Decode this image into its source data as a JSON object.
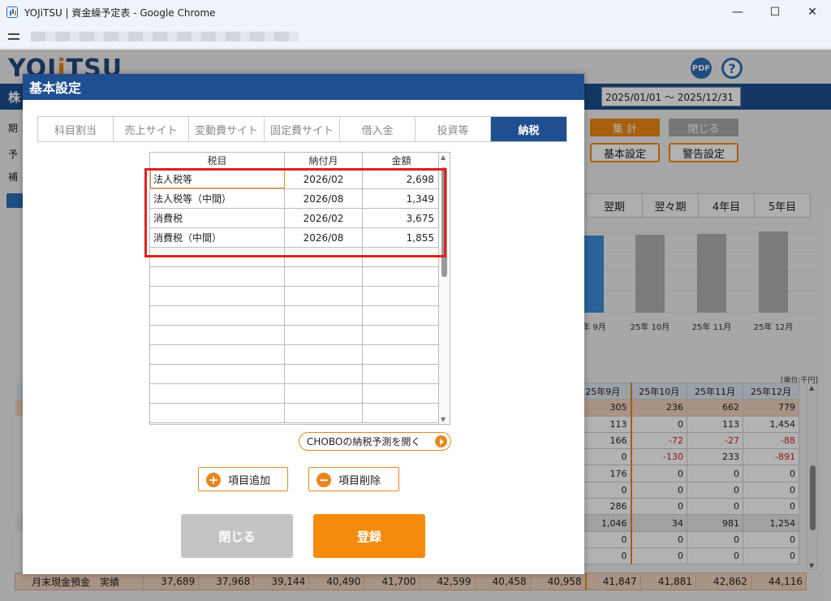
{
  "window": {
    "title": "YOJiTSU | 資金繰予定表 - Google Chrome",
    "minimize": "—",
    "maximize": "☐",
    "close": "✕"
  },
  "app": {
    "logo": {
      "a": "Y",
      "b": "O",
      "c": "J",
      "d": "i",
      "e": "TSU"
    },
    "pdf_label": "PDF",
    "help_label": "?",
    "company_prefix": "株",
    "date_range": "2025/01/01 〜 2025/12/31",
    "labels": {
      "period": "期",
      "plan": "予",
      "supplement": "補"
    },
    "buttons": {
      "aggregate": "集 計",
      "close": "閉じる",
      "basic_settings": "基本設定",
      "warning_settings": "警告設定"
    },
    "period_tabs": [
      "翌期",
      "翌々期",
      "4年目",
      "5年目"
    ],
    "chart_labels": [
      "年 9月",
      "25年 10月",
      "25年 11月",
      "25年 12月"
    ],
    "unit": "[単位:千円]",
    "grid": {
      "headers": [
        "25年9月",
        "25年10月",
        "25年11月",
        "25年12月"
      ],
      "rows": [
        {
          "style": "peach",
          "values": [
            "305",
            "236",
            "662",
            "779"
          ]
        },
        {
          "style": "",
          "values": [
            "113",
            "0",
            "113",
            "1,454"
          ]
        },
        {
          "style": "",
          "values": [
            "166",
            "-72",
            "-27",
            "-88"
          ]
        },
        {
          "style": "",
          "values": [
            "0",
            "-130",
            "233",
            "-891"
          ]
        },
        {
          "style": "",
          "values": [
            "176",
            "0",
            "0",
            "0"
          ]
        },
        {
          "style": "",
          "values": [
            "0",
            "0",
            "0",
            "0"
          ]
        },
        {
          "style": "",
          "values": [
            "286",
            "0",
            "0",
            "0"
          ]
        },
        {
          "style": "gray",
          "values": [
            "1,046",
            "34",
            "981",
            "1,254"
          ]
        },
        {
          "style": "",
          "values": [
            "0",
            "0",
            "0",
            "0"
          ]
        },
        {
          "style": "",
          "values": [
            "0",
            "0",
            "0",
            "0"
          ]
        }
      ]
    },
    "total_row": {
      "label": "月末現金預金　実績",
      "values": [
        "37,689",
        "37,968",
        "39,144",
        "40,490",
        "41,700",
        "42,599",
        "40,458",
        "40,958",
        "41,847",
        "41,881",
        "42,862",
        "44,116"
      ]
    }
  },
  "modal": {
    "title": "基本設定",
    "tabs": [
      {
        "label": "科目割当",
        "active": false
      },
      {
        "label": "売上サイト",
        "active": false
      },
      {
        "label": "変動費サイト",
        "active": false
      },
      {
        "label": "固定費サイト",
        "active": false
      },
      {
        "label": "借入金",
        "active": false
      },
      {
        "label": "投資等",
        "active": false
      },
      {
        "label": "納税",
        "active": true
      }
    ],
    "table": {
      "headers": [
        "税目",
        "納付月",
        "金額"
      ],
      "rows": [
        [
          "法人税等",
          "2026/02",
          "2,698"
        ],
        [
          "法人税等（中間）",
          "2026/08",
          "1,349"
        ],
        [
          "消費税",
          "2026/02",
          "3,675"
        ],
        [
          "消費税（中間）",
          "2026/08",
          "1,855"
        ],
        [
          "",
          "",
          ""
        ],
        [
          "",
          "",
          ""
        ],
        [
          "",
          "",
          ""
        ],
        [
          "",
          "",
          ""
        ],
        [
          "",
          "",
          ""
        ],
        [
          "",
          "",
          ""
        ],
        [
          "",
          "",
          ""
        ],
        [
          "",
          "",
          ""
        ],
        [
          "",
          "",
          ""
        ]
      ]
    },
    "chobo_link": "CHOBOの納税予測を開く",
    "add_button": "項目追加",
    "delete_button": "項目削除",
    "close_button": "閉じる",
    "save_button": "登録"
  },
  "colors": {
    "brand_blue": "#1f4f91",
    "accent_orange": "#ef8a12",
    "highlight_red": "#e02020"
  }
}
